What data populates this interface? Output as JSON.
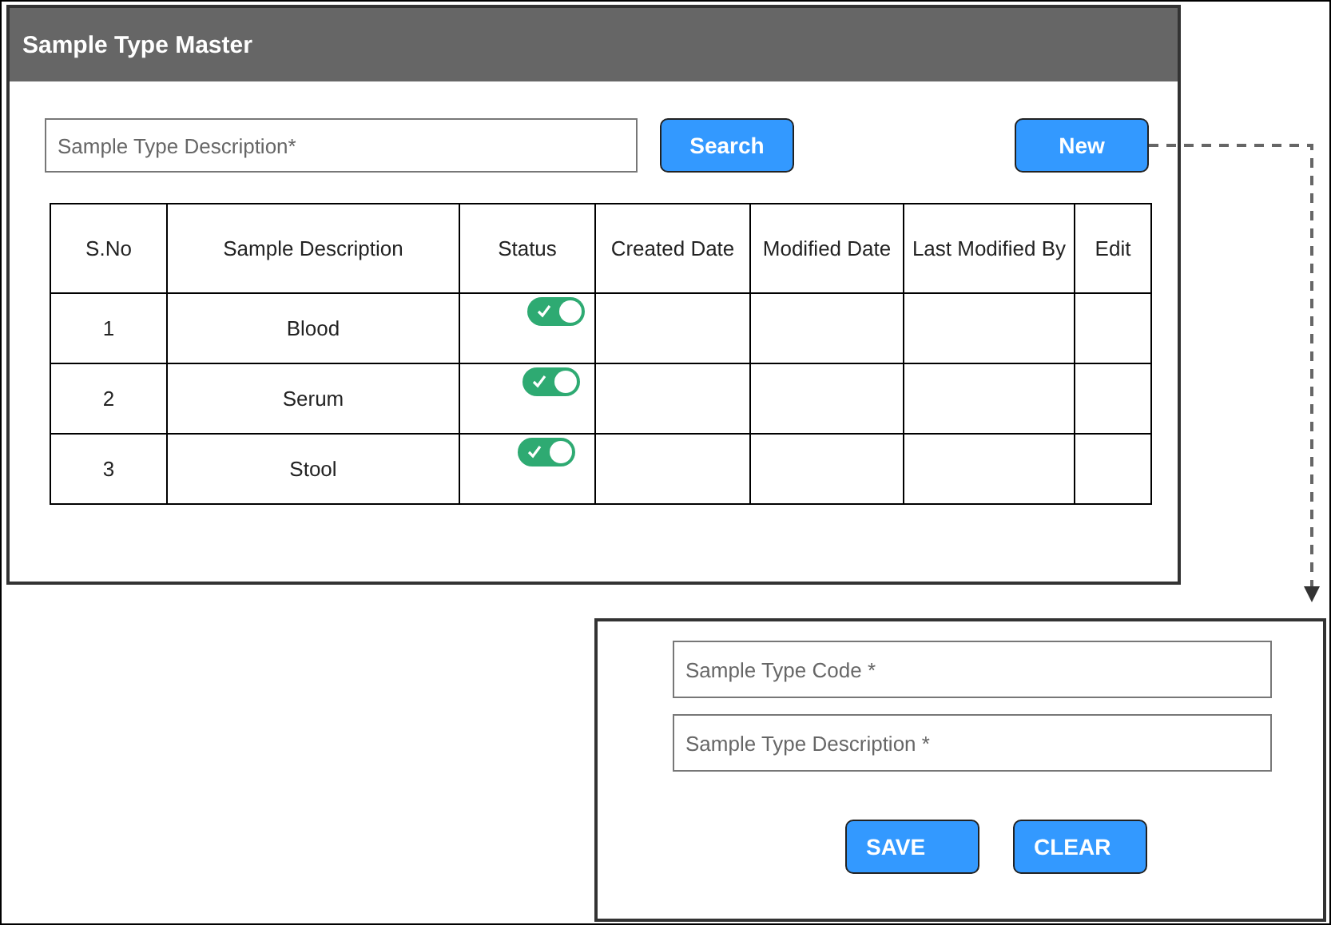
{
  "window": {
    "title": "Sample Type Master"
  },
  "search": {
    "placeholder": "Sample Type Description*"
  },
  "buttons": {
    "search": "Search",
    "new": "New"
  },
  "table": {
    "columns": [
      "S.No",
      "Sample Description",
      "Status",
      "Created Date",
      "Modified Date",
      "Last Modified By",
      "Edit"
    ],
    "rows": [
      {
        "sno": "1",
        "description": "Blood",
        "on": true
      },
      {
        "sno": "2",
        "description": "Serum",
        "on": true
      },
      {
        "sno": "3",
        "description": "Stool",
        "on": true
      }
    ]
  },
  "form": {
    "fields": [
      {
        "placeholder": "Sample Type Code *"
      },
      {
        "placeholder": "Sample Type Description *"
      }
    ],
    "buttons": [
      "SAVE",
      "CLEAR"
    ]
  }
}
